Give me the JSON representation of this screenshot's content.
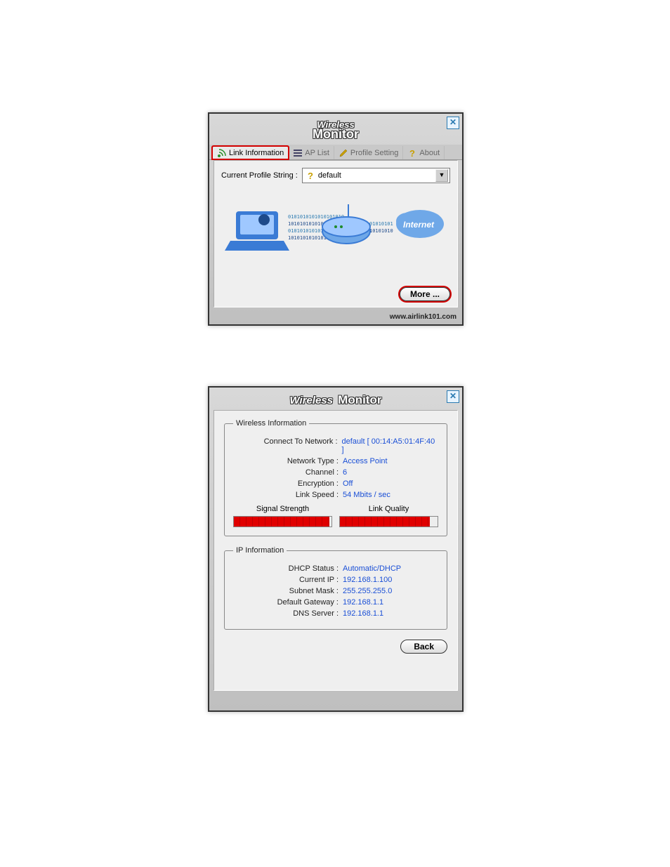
{
  "app_title": {
    "wireless": "Wireless",
    "monitor": "Monitor"
  },
  "tabs": {
    "link_info": "Link Information",
    "ap_list": "AP List",
    "profile_setting": "Profile Setting",
    "about": "About"
  },
  "main": {
    "profile_label": "Current Profile String :",
    "profile_value": "default",
    "more_label": "More ...",
    "internet_label": "Internet",
    "footer_url": "www.airlink101.com"
  },
  "details": {
    "wireless_legend": "Wireless Information",
    "fields": {
      "connect_label": "Connect To Network :",
      "connect_value": "default [ 00:14:A5:01:4F:40 ]",
      "type_label": "Network Type :",
      "type_value": "Access Point",
      "channel_label": "Channel :",
      "channel_value": "6",
      "encryption_label": "Encryption :",
      "encryption_value": "Off",
      "speed_label": "Link Speed :",
      "speed_value": "54 Mbits / sec"
    },
    "signal": {
      "strength_label": "Signal Strength",
      "quality_label": "Link Quality",
      "strength_pct": 98,
      "quality_pct": 92
    },
    "ip_legend": "IP Information",
    "ip": {
      "dhcp_label": "DHCP Status :",
      "dhcp_value": "Automatic/DHCP",
      "ip_label": "Current IP :",
      "ip_value": "192.168.1.100",
      "mask_label": "Subnet Mask :",
      "mask_value": "255.255.255.0",
      "gw_label": "Default Gateway :",
      "gw_value": "192.168.1.1",
      "dns_label": "DNS Server :",
      "dns_value": "192.168.1.1"
    },
    "back_label": "Back"
  }
}
